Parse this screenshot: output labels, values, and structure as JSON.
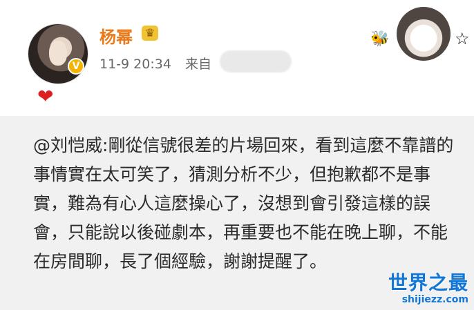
{
  "post": {
    "username": "杨幂",
    "time": "11-9 20:34",
    "source_prefix": "来自",
    "reaction_icon": "heart-icon",
    "content": "@刘恺威:剛從信號很差的片場回來，看到這麼不靠譜的事情實在太可笑了，猜測分析不少，但抱歉都不是事實，難為有心人這麼操心了，沒想到會引發這樣的誤會，只能說以後碰劇本，再重要也不能在晚上聊，不能在房間聊，長了個經驗，謝謝提醒了。"
  },
  "watermark": {
    "main": "世界之最",
    "sub": "shijiezz.com"
  },
  "colors": {
    "username": "#e97a1b",
    "heart": "#dc1f1f",
    "box_background": "#f1f1f1",
    "watermark": "#1276d6"
  }
}
